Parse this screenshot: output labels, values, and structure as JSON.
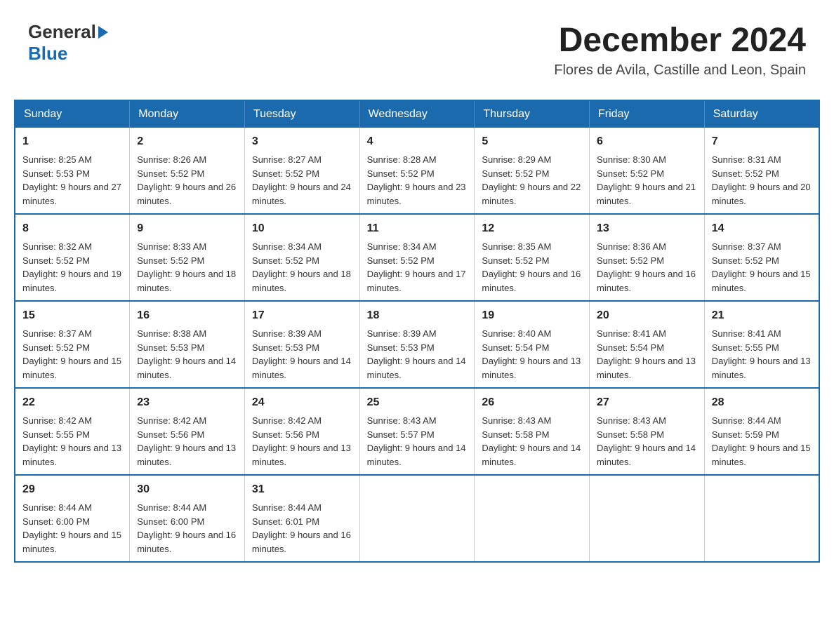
{
  "header": {
    "month_title": "December 2024",
    "location": "Flores de Avila, Castille and Leon, Spain",
    "logo_general": "General",
    "logo_blue": "Blue"
  },
  "weekdays": [
    "Sunday",
    "Monday",
    "Tuesday",
    "Wednesday",
    "Thursday",
    "Friday",
    "Saturday"
  ],
  "weeks": [
    [
      {
        "day": "1",
        "sunrise": "8:25 AM",
        "sunset": "5:53 PM",
        "daylight": "9 hours and 27 minutes."
      },
      {
        "day": "2",
        "sunrise": "8:26 AM",
        "sunset": "5:52 PM",
        "daylight": "9 hours and 26 minutes."
      },
      {
        "day": "3",
        "sunrise": "8:27 AM",
        "sunset": "5:52 PM",
        "daylight": "9 hours and 24 minutes."
      },
      {
        "day": "4",
        "sunrise": "8:28 AM",
        "sunset": "5:52 PM",
        "daylight": "9 hours and 23 minutes."
      },
      {
        "day": "5",
        "sunrise": "8:29 AM",
        "sunset": "5:52 PM",
        "daylight": "9 hours and 22 minutes."
      },
      {
        "day": "6",
        "sunrise": "8:30 AM",
        "sunset": "5:52 PM",
        "daylight": "9 hours and 21 minutes."
      },
      {
        "day": "7",
        "sunrise": "8:31 AM",
        "sunset": "5:52 PM",
        "daylight": "9 hours and 20 minutes."
      }
    ],
    [
      {
        "day": "8",
        "sunrise": "8:32 AM",
        "sunset": "5:52 PM",
        "daylight": "9 hours and 19 minutes."
      },
      {
        "day": "9",
        "sunrise": "8:33 AM",
        "sunset": "5:52 PM",
        "daylight": "9 hours and 18 minutes."
      },
      {
        "day": "10",
        "sunrise": "8:34 AM",
        "sunset": "5:52 PM",
        "daylight": "9 hours and 18 minutes."
      },
      {
        "day": "11",
        "sunrise": "8:34 AM",
        "sunset": "5:52 PM",
        "daylight": "9 hours and 17 minutes."
      },
      {
        "day": "12",
        "sunrise": "8:35 AM",
        "sunset": "5:52 PM",
        "daylight": "9 hours and 16 minutes."
      },
      {
        "day": "13",
        "sunrise": "8:36 AM",
        "sunset": "5:52 PM",
        "daylight": "9 hours and 16 minutes."
      },
      {
        "day": "14",
        "sunrise": "8:37 AM",
        "sunset": "5:52 PM",
        "daylight": "9 hours and 15 minutes."
      }
    ],
    [
      {
        "day": "15",
        "sunrise": "8:37 AM",
        "sunset": "5:52 PM",
        "daylight": "9 hours and 15 minutes."
      },
      {
        "day": "16",
        "sunrise": "8:38 AM",
        "sunset": "5:53 PM",
        "daylight": "9 hours and 14 minutes."
      },
      {
        "day": "17",
        "sunrise": "8:39 AM",
        "sunset": "5:53 PM",
        "daylight": "9 hours and 14 minutes."
      },
      {
        "day": "18",
        "sunrise": "8:39 AM",
        "sunset": "5:53 PM",
        "daylight": "9 hours and 14 minutes."
      },
      {
        "day": "19",
        "sunrise": "8:40 AM",
        "sunset": "5:54 PM",
        "daylight": "9 hours and 13 minutes."
      },
      {
        "day": "20",
        "sunrise": "8:41 AM",
        "sunset": "5:54 PM",
        "daylight": "9 hours and 13 minutes."
      },
      {
        "day": "21",
        "sunrise": "8:41 AM",
        "sunset": "5:55 PM",
        "daylight": "9 hours and 13 minutes."
      }
    ],
    [
      {
        "day": "22",
        "sunrise": "8:42 AM",
        "sunset": "5:55 PM",
        "daylight": "9 hours and 13 minutes."
      },
      {
        "day": "23",
        "sunrise": "8:42 AM",
        "sunset": "5:56 PM",
        "daylight": "9 hours and 13 minutes."
      },
      {
        "day": "24",
        "sunrise": "8:42 AM",
        "sunset": "5:56 PM",
        "daylight": "9 hours and 13 minutes."
      },
      {
        "day": "25",
        "sunrise": "8:43 AM",
        "sunset": "5:57 PM",
        "daylight": "9 hours and 14 minutes."
      },
      {
        "day": "26",
        "sunrise": "8:43 AM",
        "sunset": "5:58 PM",
        "daylight": "9 hours and 14 minutes."
      },
      {
        "day": "27",
        "sunrise": "8:43 AM",
        "sunset": "5:58 PM",
        "daylight": "9 hours and 14 minutes."
      },
      {
        "day": "28",
        "sunrise": "8:44 AM",
        "sunset": "5:59 PM",
        "daylight": "9 hours and 15 minutes."
      }
    ],
    [
      {
        "day": "29",
        "sunrise": "8:44 AM",
        "sunset": "6:00 PM",
        "daylight": "9 hours and 15 minutes."
      },
      {
        "day": "30",
        "sunrise": "8:44 AM",
        "sunset": "6:00 PM",
        "daylight": "9 hours and 16 minutes."
      },
      {
        "day": "31",
        "sunrise": "8:44 AM",
        "sunset": "6:01 PM",
        "daylight": "9 hours and 16 minutes."
      },
      null,
      null,
      null,
      null
    ]
  ],
  "labels": {
    "sunrise": "Sunrise:",
    "sunset": "Sunset:",
    "daylight": "Daylight:"
  }
}
